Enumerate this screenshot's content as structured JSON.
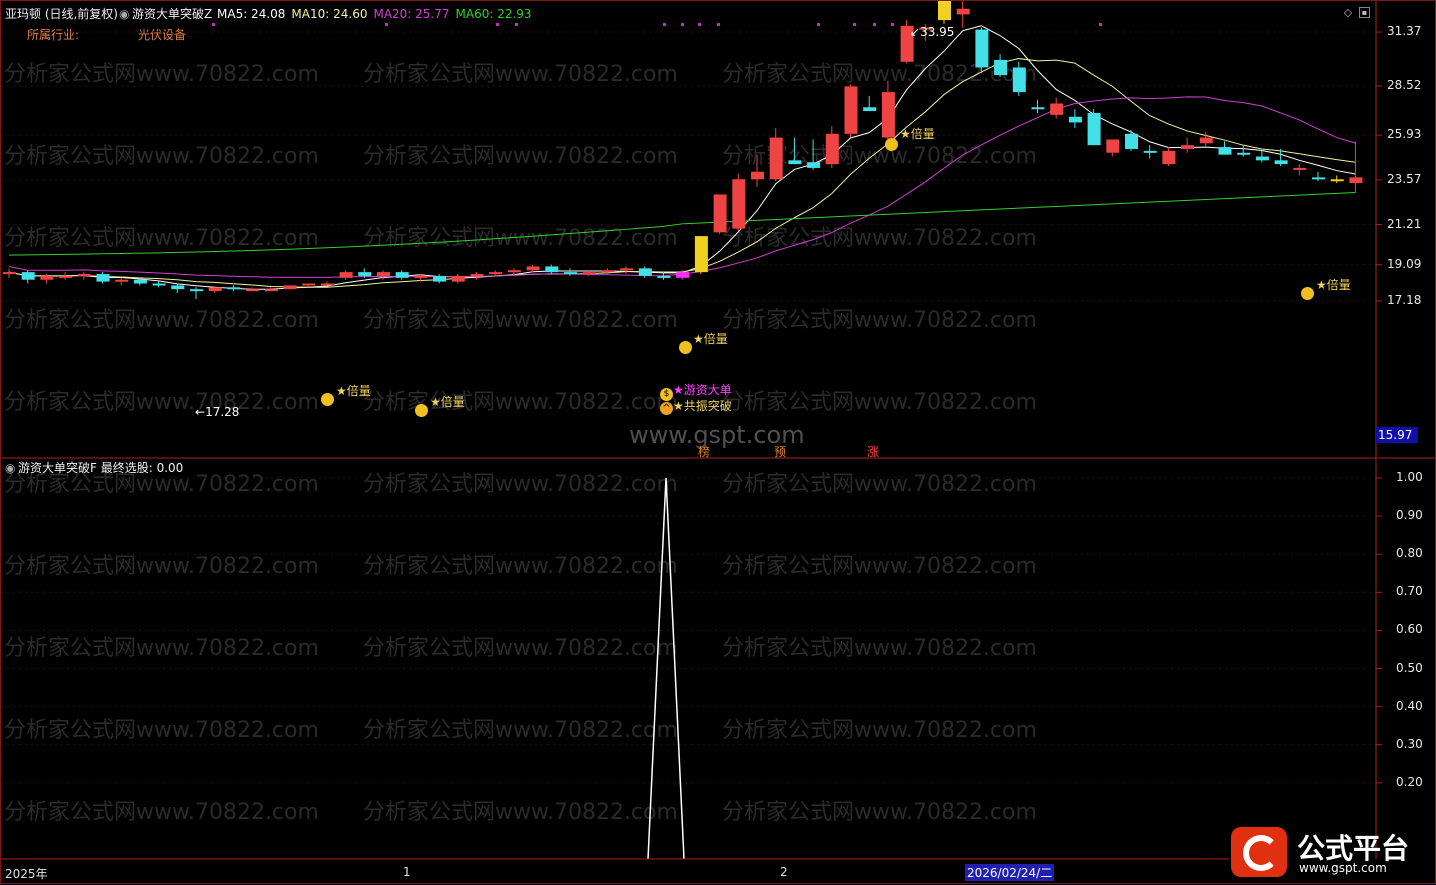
{
  "header": {
    "stock": "亚玛顿 (日线,前复权)",
    "indicator": "游资大单突破Z",
    "ma": [
      {
        "label": "MA5: 24.08",
        "color": "#ffffff"
      },
      {
        "label": "MA10: 24.60",
        "color": "#f2f2a0"
      },
      {
        "label": "MA20: 25.77",
        "color": "#d040d0"
      },
      {
        "label": "MA60: 22.93",
        "color": "#30d030"
      }
    ],
    "industry_label": "所属行业:",
    "industry_value": "光伏设备"
  },
  "price_axis": [
    "31.37",
    "28.52",
    "25.93",
    "23.57",
    "21.21",
    "19.09",
    "17.18"
  ],
  "current_price": "15.97",
  "annotations": {
    "high": "33.95",
    "low": "17.28",
    "signal_big": "★游资大单",
    "signal_breakout": "★共振突破",
    "signal_double": "★倍量",
    "tags": [
      "榜",
      "预",
      "涨"
    ],
    "site": "www.gspt.com"
  },
  "sub_panel": {
    "title": "游资大单突破F  最终选股: 0.00",
    "axis": [
      "1.00",
      "0.90",
      "0.80",
      "0.70",
      "0.60",
      "0.50",
      "0.40",
      "0.30",
      "0.20"
    ]
  },
  "time_axis": {
    "year": "2025年",
    "m1": "1",
    "m2": "2",
    "cursor_date": "2026/02/24/二"
  },
  "watermark": "分析家公式网www.70822.com",
  "logo": {
    "text": "公式平台",
    "url": "www.gspt.com"
  },
  "colors": {
    "up": "#ee4444",
    "down": "#44e0e8",
    "ma5": "#ffffff",
    "ma10": "#f2f2a0",
    "ma20": "#d040d0",
    "ma60": "#30d030",
    "panel_border": "#8a1a1a"
  },
  "chart_data": {
    "type": "candlestick",
    "candles": [
      {
        "o": 18.6,
        "h": 18.9,
        "l": 18.4,
        "c": 18.7
      },
      {
        "o": 18.7,
        "h": 18.8,
        "l": 18.1,
        "c": 18.3
      },
      {
        "o": 18.3,
        "h": 18.6,
        "l": 18.1,
        "c": 18.5
      },
      {
        "o": 18.5,
        "h": 18.7,
        "l": 18.3,
        "c": 18.5
      },
      {
        "o": 18.5,
        "h": 18.7,
        "l": 18.3,
        "c": 18.6
      },
      {
        "o": 18.6,
        "h": 18.7,
        "l": 18.1,
        "c": 18.2
      },
      {
        "o": 18.2,
        "h": 18.4,
        "l": 18.0,
        "c": 18.3
      },
      {
        "o": 18.3,
        "h": 18.4,
        "l": 18.0,
        "c": 18.1
      },
      {
        "o": 18.1,
        "h": 18.2,
        "l": 17.9,
        "c": 18.0
      },
      {
        "o": 18.0,
        "h": 18.1,
        "l": 17.6,
        "c": 17.8
      },
      {
        "o": 17.8,
        "h": 17.9,
        "l": 17.28,
        "c": 17.7
      },
      {
        "o": 17.7,
        "h": 17.9,
        "l": 17.6,
        "c": 17.9
      },
      {
        "o": 17.9,
        "h": 18.0,
        "l": 17.7,
        "c": 17.8
      },
      {
        "o": 17.8,
        "h": 17.9,
        "l": 17.7,
        "c": 17.8
      },
      {
        "o": 17.8,
        "h": 17.9,
        "l": 17.7,
        "c": 17.8
      },
      {
        "o": 17.8,
        "h": 18.0,
        "l": 17.8,
        "c": 18.0
      },
      {
        "o": 18.0,
        "h": 18.1,
        "l": 17.9,
        "c": 18.1
      },
      {
        "o": 18.1,
        "h": 18.2,
        "l": 18.0,
        "c": 18.1
      },
      {
        "o": 18.4,
        "h": 18.8,
        "l": 18.3,
        "c": 18.7
      },
      {
        "o": 18.7,
        "h": 18.9,
        "l": 18.4,
        "c": 18.5
      },
      {
        "o": 18.5,
        "h": 18.8,
        "l": 18.3,
        "c": 18.7
      },
      {
        "o": 18.7,
        "h": 18.8,
        "l": 18.3,
        "c": 18.4
      },
      {
        "o": 18.4,
        "h": 18.6,
        "l": 18.2,
        "c": 18.5
      },
      {
        "o": 18.5,
        "h": 18.6,
        "l": 18.1,
        "c": 18.2
      },
      {
        "o": 18.2,
        "h": 18.6,
        "l": 18.1,
        "c": 18.5
      },
      {
        "o": 18.5,
        "h": 18.7,
        "l": 18.3,
        "c": 18.6
      },
      {
        "o": 18.6,
        "h": 18.8,
        "l": 18.5,
        "c": 18.7
      },
      {
        "o": 18.7,
        "h": 18.9,
        "l": 18.5,
        "c": 18.8
      },
      {
        "o": 18.8,
        "h": 19.1,
        "l": 18.7,
        "c": 19.0
      },
      {
        "o": 19.0,
        "h": 19.1,
        "l": 18.6,
        "c": 18.7
      },
      {
        "o": 18.7,
        "h": 18.9,
        "l": 18.5,
        "c": 18.6
      },
      {
        "o": 18.6,
        "h": 18.8,
        "l": 18.5,
        "c": 18.7
      },
      {
        "o": 18.7,
        "h": 18.9,
        "l": 18.6,
        "c": 18.8
      },
      {
        "o": 18.8,
        "h": 19.0,
        "l": 18.6,
        "c": 18.9
      },
      {
        "o": 18.9,
        "h": 19.0,
        "l": 18.4,
        "c": 18.5
      },
      {
        "o": 18.5,
        "h": 18.7,
        "l": 18.3,
        "c": 18.4
      },
      {
        "o": 18.4,
        "h": 18.8,
        "l": 18.3,
        "c": 18.7
      },
      {
        "o": 18.7,
        "h": 20.6,
        "l": 18.6,
        "c": 20.6
      },
      {
        "o": 20.8,
        "h": 22.8,
        "l": 20.7,
        "c": 22.8
      },
      {
        "o": 21.0,
        "h": 23.9,
        "l": 20.9,
        "c": 23.6
      },
      {
        "o": 23.6,
        "h": 24.9,
        "l": 23.2,
        "c": 24.0
      },
      {
        "o": 23.6,
        "h": 26.3,
        "l": 23.5,
        "c": 25.8
      },
      {
        "o": 24.6,
        "h": 25.8,
        "l": 24.4,
        "c": 24.4
      },
      {
        "o": 24.5,
        "h": 25.7,
        "l": 24.1,
        "c": 24.2
      },
      {
        "o": 24.4,
        "h": 26.4,
        "l": 24.2,
        "c": 26.0
      },
      {
        "o": 26.0,
        "h": 28.6,
        "l": 25.8,
        "c": 28.5
      },
      {
        "o": 27.4,
        "h": 28.0,
        "l": 27.2,
        "c": 27.2
      },
      {
        "o": 25.8,
        "h": 28.8,
        "l": 25.7,
        "c": 28.2
      },
      {
        "o": 29.8,
        "h": 32.0,
        "l": 29.7,
        "c": 31.7
      },
      {
        "o": 31.6,
        "h": 31.8,
        "l": 30.9,
        "c": 31.6
      },
      {
        "o": 32.0,
        "h": 33.8,
        "l": 31.8,
        "c": 33.1
      },
      {
        "o": 32.3,
        "h": 33.95,
        "l": 31.6,
        "c": 32.6
      },
      {
        "o": 31.5,
        "h": 31.6,
        "l": 29.2,
        "c": 29.5
      },
      {
        "o": 29.9,
        "h": 30.2,
        "l": 29.0,
        "c": 29.1
      },
      {
        "o": 29.5,
        "h": 29.8,
        "l": 28.0,
        "c": 28.2
      },
      {
        "o": 27.4,
        "h": 27.8,
        "l": 27.1,
        "c": 27.3
      },
      {
        "o": 27.0,
        "h": 27.9,
        "l": 26.8,
        "c": 27.6
      },
      {
        "o": 26.9,
        "h": 27.3,
        "l": 26.3,
        "c": 26.6
      },
      {
        "o": 27.1,
        "h": 27.3,
        "l": 25.4,
        "c": 25.4
      },
      {
        "o": 25.0,
        "h": 25.7,
        "l": 24.8,
        "c": 25.7
      },
      {
        "o": 26.0,
        "h": 26.2,
        "l": 25.1,
        "c": 25.2
      },
      {
        "o": 25.1,
        "h": 25.4,
        "l": 24.7,
        "c": 25.0
      },
      {
        "o": 24.4,
        "h": 25.3,
        "l": 24.3,
        "c": 25.1
      },
      {
        "o": 25.2,
        "h": 25.8,
        "l": 25.0,
        "c": 25.4
      },
      {
        "o": 25.5,
        "h": 26.1,
        "l": 25.3,
        "c": 25.8
      },
      {
        "o": 25.3,
        "h": 25.6,
        "l": 24.9,
        "c": 24.9
      },
      {
        "o": 25.0,
        "h": 25.4,
        "l": 24.8,
        "c": 24.9
      },
      {
        "o": 24.8,
        "h": 25.1,
        "l": 24.5,
        "c": 24.6
      },
      {
        "o": 24.6,
        "h": 25.2,
        "l": 24.3,
        "c": 24.4
      },
      {
        "o": 24.1,
        "h": 24.4,
        "l": 23.8,
        "c": 24.2
      },
      {
        "o": 23.7,
        "h": 24.0,
        "l": 23.5,
        "c": 23.6
      },
      {
        "o": 23.6,
        "h": 23.8,
        "l": 23.4,
        "c": 23.5
      },
      {
        "o": 23.4,
        "h": 25.6,
        "l": 22.9,
        "c": 23.7
      }
    ],
    "y_range": [
      16.5,
      34.5
    ],
    "y_ticks": [
      31.37,
      28.52,
      25.93,
      23.57,
      21.21,
      19.09,
      17.18
    ],
    "sub_series": {
      "name": "最终选股",
      "peak_index": 37,
      "peak_value": 1.0,
      "y_range": [
        0,
        1.05
      ]
    }
  }
}
